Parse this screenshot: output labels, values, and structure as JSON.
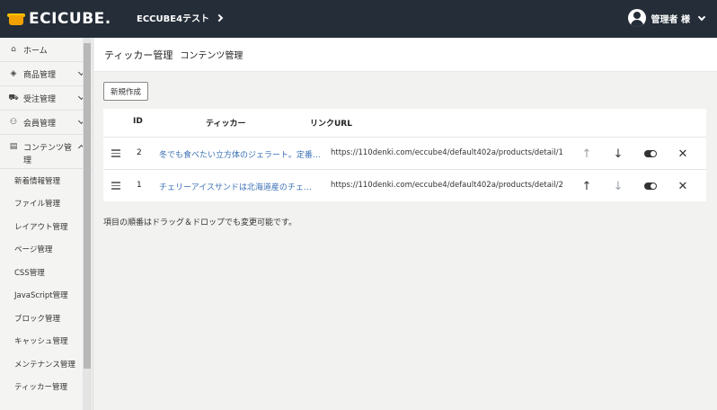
{
  "header": {
    "logo_text": "ECICUBE.",
    "shop_name": "ECCUBE4テスト",
    "user_name": "管理者 様"
  },
  "sidebar": {
    "menus": [
      {
        "label": "ホーム",
        "icon": "home-icon"
      },
      {
        "label": "商品管理",
        "icon": "cube-icon"
      },
      {
        "label": "受注管理",
        "icon": "cart-icon"
      },
      {
        "label": "会員管理",
        "icon": "users-icon"
      },
      {
        "label": "コンテンツ管理",
        "icon": "file-icon"
      }
    ],
    "submenu": [
      {
        "label": "新着情報管理"
      },
      {
        "label": "ファイル管理"
      },
      {
        "label": "レイアウト管理"
      },
      {
        "label": "ページ管理"
      },
      {
        "label": "CSS管理"
      },
      {
        "label": "JavaScript管理"
      },
      {
        "label": "ブロック管理"
      },
      {
        "label": "キャッシュ管理"
      },
      {
        "label": "メンテナンス管理"
      },
      {
        "label": "ティッカー管理"
      }
    ]
  },
  "page": {
    "title": "ティッカー管理",
    "subtitle": "コンテンツ管理",
    "new_button": "新規作成",
    "note": "項目の順番はドラッグ＆ドロップでも変更可能です。"
  },
  "table": {
    "headers": {
      "id": "ID",
      "ticker": "ティッカー",
      "url": "リンクURL"
    },
    "rows": [
      {
        "id": "2",
        "ticker": "冬でも食べたい立方体のジェラート。定番…",
        "url": "https://110denki.com/eccube4/default402a/products/detail/1"
      },
      {
        "id": "1",
        "ticker": "チェリーアイスサンドは北海道産のチェ…",
        "url": "https://110denki.com/eccube4/default402a/products/detail/2"
      }
    ]
  }
}
